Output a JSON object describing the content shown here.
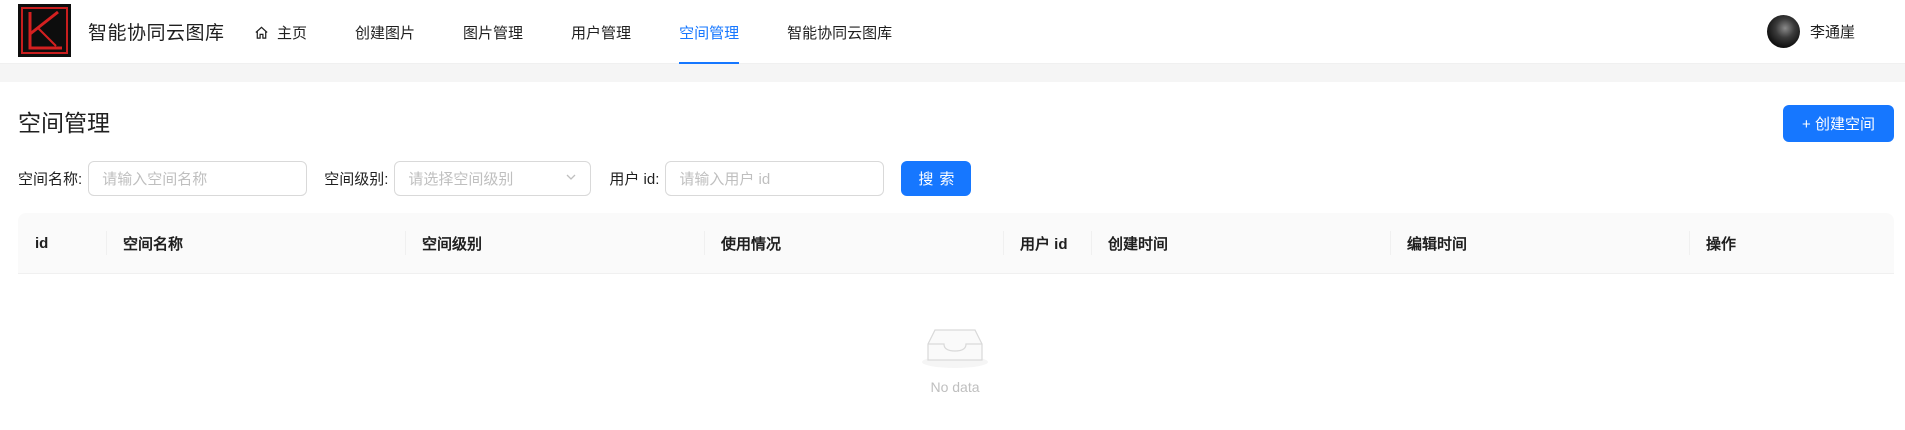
{
  "header": {
    "site_title": "智能协同云图库",
    "nav": [
      {
        "label": "主页",
        "icon": "home-icon",
        "active": false
      },
      {
        "label": "创建图片",
        "active": false
      },
      {
        "label": "图片管理",
        "active": false
      },
      {
        "label": "用户管理",
        "active": false
      },
      {
        "label": "空间管理",
        "active": true
      },
      {
        "label": "智能协同云图库",
        "active": false
      }
    ],
    "user_name": "李通崖"
  },
  "page": {
    "title": "空间管理",
    "create_button": "+ 创建空间"
  },
  "filters": {
    "space_name_label": "空间名称",
    "space_name_placeholder": "请输入空间名称",
    "space_level_label": "空间级别",
    "space_level_placeholder": "请选择空间级别",
    "user_id_label": "用户 id",
    "user_id_placeholder": "请输入用户 id",
    "search_button": "搜索"
  },
  "table": {
    "columns": [
      "id",
      "空间名称",
      "空间级别",
      "使用情况",
      "用户 id",
      "创建时间",
      "编辑时间",
      "操作"
    ],
    "empty_text": "No data"
  },
  "colors": {
    "primary": "#1677ff"
  }
}
